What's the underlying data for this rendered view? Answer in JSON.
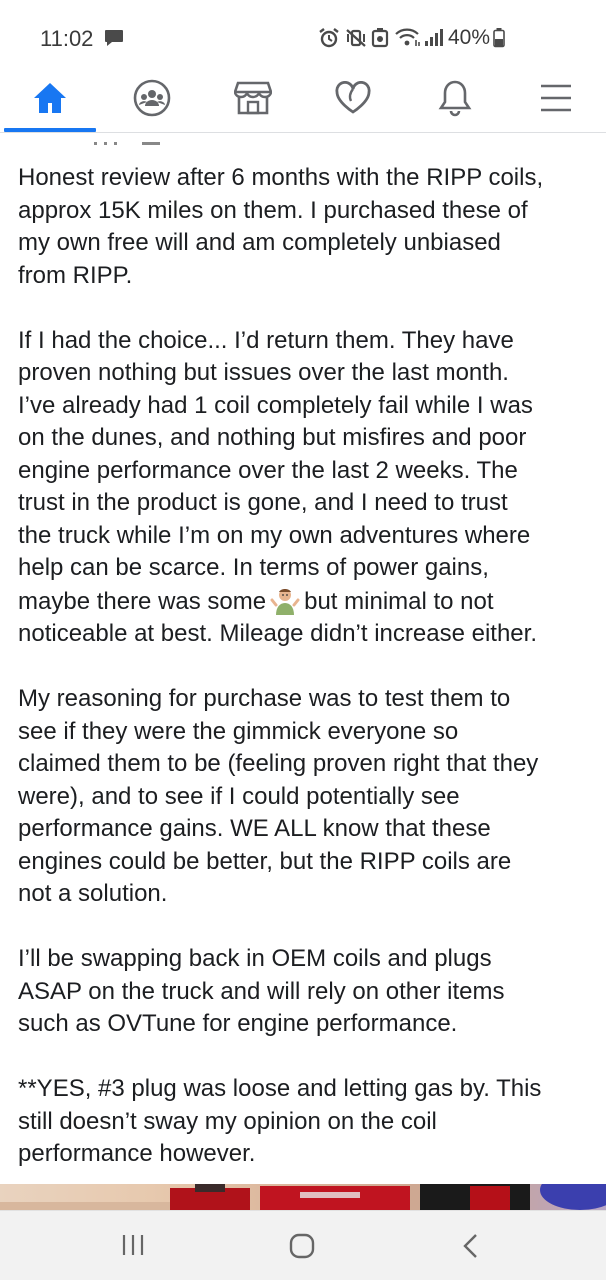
{
  "status_bar": {
    "time": "11:02",
    "battery": "40%"
  },
  "nav": {
    "tabs": [
      {
        "name": "home-icon",
        "active": true
      },
      {
        "name": "groups-icon",
        "active": false
      },
      {
        "name": "marketplace-icon",
        "active": false
      },
      {
        "name": "dating-heart-icon",
        "active": false
      },
      {
        "name": "notifications-bell-icon",
        "active": false
      },
      {
        "name": "menu-icon",
        "active": false
      }
    ],
    "accent_color": "#1877f2"
  },
  "post": {
    "p1": [
      "Honest review after 6 months with the RIPP coils,",
      "approx 15K miles on them. I purchased these of",
      "my own free will and am completely unbiased",
      "from RIPP."
    ],
    "p2": [
      "If I had the choice... I’d return them. They have",
      "proven nothing but issues over the last month.",
      "I’ve already had 1 coil completely fail while I was",
      "on the dunes, and nothing but misfires and poor",
      "engine performance over the last 2 weeks. The",
      "trust in the product is gone, and I need to trust",
      "the truck while I’m on my own adventures where",
      "help can be scarce. In terms of power gains,"
    ],
    "p2_emoji_line_before": "maybe there was some",
    "p2_emoji_line_after": "but minimal to not",
    "p2_last": "noticeable at best. Mileage didn’t increase either.",
    "p3": [
      "My reasoning for purchase was to test them to",
      "see if they were the gimmick everyone so",
      "claimed them to be (feeling proven right that they",
      "were), and to see if I could potentially see",
      "performance gains. WE ALL know that these",
      "engines could be better, but the RIPP coils are",
      "not a solution."
    ],
    "p4": [
      "I’ll be swapping back in OEM coils and plugs",
      "ASAP on the truck and will rely on other items",
      "such as OVTune for engine performance."
    ],
    "p5": [
      "**YES, #3 plug was loose and letting gas by. This",
      "still doesn’t sway my opinion on the coil",
      "performance however."
    ]
  }
}
